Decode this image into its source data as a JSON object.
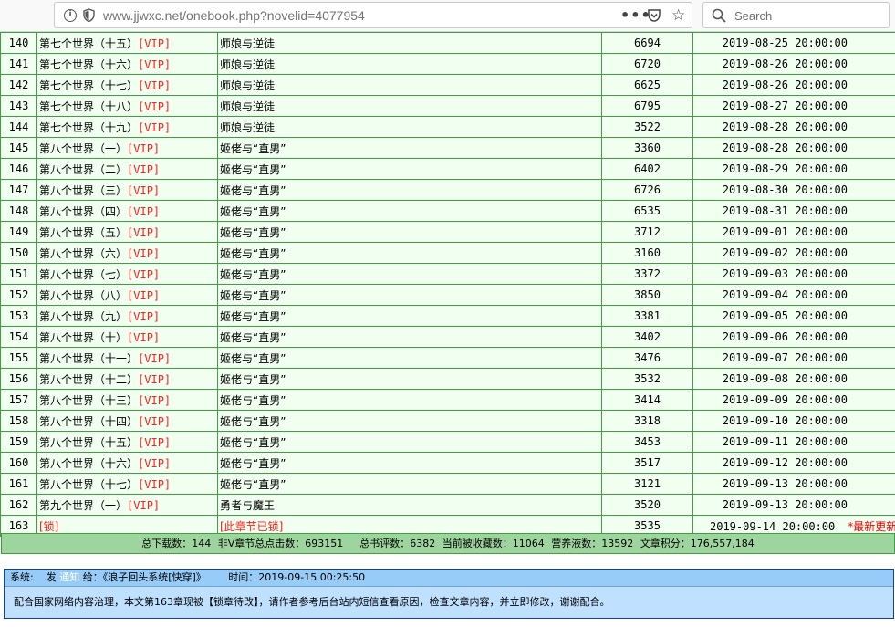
{
  "browser": {
    "url_host": "www.jjwxc.net",
    "url_path": "/onebook.php?novelid=4077954",
    "search_placeholder": "Search"
  },
  "chapters": [
    {
      "num": "140",
      "title": "第七个世界（十五）",
      "vip": "[VIP]",
      "summary": "师娘与逆徒",
      "words": "6694",
      "time": "2019-08-25 20:00:00"
    },
    {
      "num": "141",
      "title": "第七个世界（十六）",
      "vip": "[VIP]",
      "summary": "师娘与逆徒",
      "words": "6720",
      "time": "2019-08-26 20:00:00"
    },
    {
      "num": "142",
      "title": "第七个世界（十七）",
      "vip": "[VIP]",
      "summary": "师娘与逆徒",
      "words": "6625",
      "time": "2019-08-26 20:00:00"
    },
    {
      "num": "143",
      "title": "第七个世界（十八）",
      "vip": "[VIP]",
      "summary": "师娘与逆徒",
      "words": "6795",
      "time": "2019-08-27 20:00:00"
    },
    {
      "num": "144",
      "title": "第七个世界（十九）",
      "vip": "[VIP]",
      "summary": "师娘与逆徒",
      "words": "3522",
      "time": "2019-08-28 20:00:00"
    },
    {
      "num": "145",
      "title": "第八个世界（一）",
      "vip": "[VIP]",
      "summary": "姬佬与“直男”",
      "words": "3360",
      "time": "2019-08-28 20:00:00"
    },
    {
      "num": "146",
      "title": "第八个世界（二）",
      "vip": "[VIP]",
      "summary": "姬佬与“直男”",
      "words": "6402",
      "time": "2019-08-29 20:00:00"
    },
    {
      "num": "147",
      "title": "第八个世界（三）",
      "vip": "[VIP]",
      "summary": "姬佬与“直男”",
      "words": "6726",
      "time": "2019-08-30 20:00:00"
    },
    {
      "num": "148",
      "title": "第八个世界（四）",
      "vip": "[VIP]",
      "summary": "姬佬与“直男”",
      "words": "6535",
      "time": "2019-08-31 20:00:00"
    },
    {
      "num": "149",
      "title": "第八个世界（五）",
      "vip": "[VIP]",
      "summary": "姬佬与“直男”",
      "words": "3712",
      "time": "2019-09-01 20:00:00"
    },
    {
      "num": "150",
      "title": "第八个世界（六）",
      "vip": "[VIP]",
      "summary": "姬佬与“直男”",
      "words": "3160",
      "time": "2019-09-02 20:00:00"
    },
    {
      "num": "151",
      "title": "第八个世界（七）",
      "vip": "[VIP]",
      "summary": "姬佬与“直男”",
      "words": "3372",
      "time": "2019-09-03 20:00:00"
    },
    {
      "num": "152",
      "title": "第八个世界（八）",
      "vip": "[VIP]",
      "summary": "姬佬与“直男”",
      "words": "3850",
      "time": "2019-09-04 20:00:00"
    },
    {
      "num": "153",
      "title": "第八个世界（九）",
      "vip": "[VIP]",
      "summary": "姬佬与“直男”",
      "words": "3381",
      "time": "2019-09-05 20:00:00"
    },
    {
      "num": "154",
      "title": "第八个世界（十）",
      "vip": "[VIP]",
      "summary": "姬佬与“直男”",
      "words": "3402",
      "time": "2019-09-06 20:00:00"
    },
    {
      "num": "155",
      "title": "第八个世界（十一）",
      "vip": "[VIP]",
      "summary": "姬佬与“直男”",
      "words": "3476",
      "time": "2019-09-07 20:00:00"
    },
    {
      "num": "156",
      "title": "第八个世界（十二）",
      "vip": "[VIP]",
      "summary": "姬佬与“直男”",
      "words": "3532",
      "time": "2019-09-08 20:00:00"
    },
    {
      "num": "157",
      "title": "第八个世界（十三）",
      "vip": "[VIP]",
      "summary": "姬佬与“直男”",
      "words": "3414",
      "time": "2019-09-09 20:00:00"
    },
    {
      "num": "158",
      "title": "第八个世界（十四）",
      "vip": "[VIP]",
      "summary": "姬佬与“直男”",
      "words": "3318",
      "time": "2019-09-10 20:00:00"
    },
    {
      "num": "159",
      "title": "第八个世界（十五）",
      "vip": "[VIP]",
      "summary": "姬佬与“直男”",
      "words": "3453",
      "time": "2019-09-11 20:00:00"
    },
    {
      "num": "160",
      "title": "第八个世界（十六）",
      "vip": "[VIP]",
      "summary": "姬佬与“直男”",
      "words": "3517",
      "time": "2019-09-12 20:00:00"
    },
    {
      "num": "161",
      "title": "第八个世界（十七）",
      "vip": "[VIP]",
      "summary": "姬佬与“直男”",
      "words": "3121",
      "time": "2019-09-13 20:00:00"
    },
    {
      "num": "162",
      "title": "第九个世界（一）",
      "vip": "[VIP]",
      "summary": "勇者与魔王",
      "words": "3520",
      "time": "2019-09-13 20:00:00"
    }
  ],
  "locked_chapter": {
    "num": "163",
    "title": "[锁]",
    "summary": "[此章节已锁]",
    "words": "3535",
    "time": "2019-09-14 20:00:00",
    "new_flag": "*最新更新"
  },
  "stats": {
    "downloads": "总下载数：144",
    "clicks": "非V章节总点击数：693151",
    "reviews": "总书评数：6382",
    "favorites": "当前被收藏数：11064",
    "nutrient": "营养液数：13592",
    "score": "文章积分：176,557,184"
  },
  "notice": {
    "label": "系统:",
    "send": "发",
    "notify_link": "通知",
    "to": "给：《浪子回头系统[快穿]》",
    "time": "时间：2019-09-15 00:25:50",
    "body": "配合国家网络内容治理，本文第163章现被【锁章待改】，请作者参考后台站内短信查看原因，检查文章内容，并立即修改，谢谢配合。"
  },
  "colors": {
    "row_bg": "#f0fff0",
    "border": "#40a040",
    "vip_red": "#ff2020",
    "stats_bg": "#9ed49e",
    "notice_bg": "#c0e0ff",
    "notice_head_bg": "#98ccf8"
  }
}
